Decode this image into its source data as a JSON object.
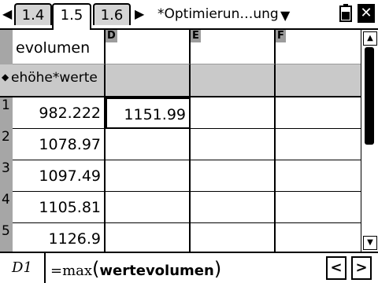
{
  "tabs": {
    "items": [
      "1.4",
      "1.5",
      "1.6"
    ],
    "active": "1.5"
  },
  "document": {
    "title": "*Optimierun…ung"
  },
  "icons": {
    "tab_prev": "triangle-left-icon",
    "tab_next": "triangle-right-icon",
    "menu": "triangle-down-icon",
    "battery": "battery-icon",
    "close": "close-x-icon"
  },
  "sheet": {
    "columns": [
      {
        "letter": "",
        "name": "evolumen",
        "formula": "ehöhe*werte"
      },
      {
        "letter": "D",
        "name": "",
        "formula": ""
      },
      {
        "letter": "E",
        "name": "",
        "formula": ""
      },
      {
        "letter": "F",
        "name": "",
        "formula": ""
      }
    ],
    "row_labels": [
      "1",
      "2",
      "3",
      "4",
      "5"
    ],
    "formula_marker": "◆",
    "rows": [
      [
        "982.222",
        "1151.99",
        "",
        ""
      ],
      [
        "1078.97",
        "",
        "",
        ""
      ],
      [
        "1097.49",
        "",
        "",
        ""
      ],
      [
        "1105.81",
        "",
        "",
        ""
      ],
      [
        "1126.9",
        "",
        "",
        ""
      ]
    ]
  },
  "entry_line": {
    "cell_ref": "D1",
    "prefix": "=max",
    "open": "(",
    "argument": "wertevolumen",
    "close": ")"
  },
  "nav": {
    "left": "<",
    "right": ">"
  }
}
